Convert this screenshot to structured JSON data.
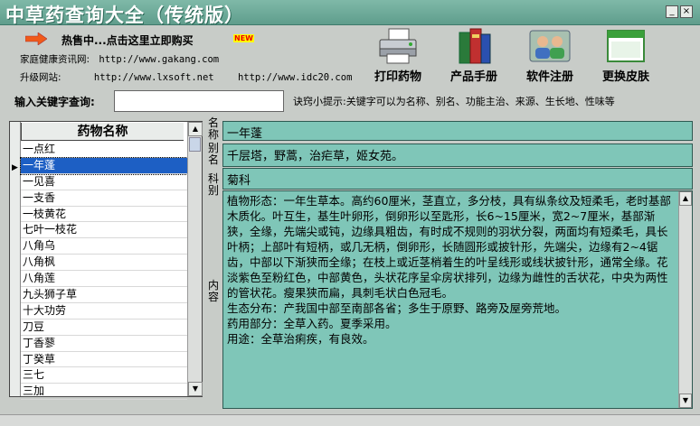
{
  "window": {
    "title": "中草药查询大全（传统版）",
    "min": "_",
    "max": "□",
    "close": "×"
  },
  "promo": {
    "text": "热售中...点击这里立即购买",
    "badge": "NEW"
  },
  "sites": [
    {
      "label": "家庭健康资讯网:",
      "url": "http://www.gakang.com"
    },
    {
      "label": "升级网站:",
      "url": "http://www.lxsoft.net",
      "url2": "http://www.idc20.com"
    }
  ],
  "toolbar": [
    {
      "label": "打印药物",
      "icon": "printer-icon"
    },
    {
      "label": "产品手册",
      "icon": "books-icon"
    },
    {
      "label": "软件注册",
      "icon": "users-icon"
    },
    {
      "label": "更换皮肤",
      "icon": "window-icon"
    }
  ],
  "search": {
    "label": "输入关键字查询:",
    "value": "",
    "tip": "诀窍小提示:关键字可以为名称、别名、功能主治、来源、生长地、性味等"
  },
  "list": {
    "header": "药物名称",
    "items": [
      "一点红",
      "一年蓬",
      "一见喜",
      "一支香",
      "一枝黄花",
      "七叶一枝花",
      "八角乌",
      "八角枫",
      "八角莲",
      "九头狮子草",
      "十大功劳",
      "刀豆",
      "丁香蓼",
      "丁癸草",
      "三七",
      "三加"
    ],
    "selected_index": 1
  },
  "detail": {
    "name_label": "名称",
    "name": "一年蓬",
    "alias_label": "别名",
    "alias": "千层塔，野蒿，治疟草，姬女苑。",
    "family_label": "科别",
    "family": "菊科",
    "content_label": "内容",
    "content": [
      "植物形态：一年生草本。高约60厘米，茎直立，多分枝，具有纵条纹及短柔毛，老时基部木质化。叶互生，基生叶卵形，倒卵形以至匙形，长6~15厘米，宽2~7厘米，基部渐狭，全缘，先端尖或钝，边缘具粗齿，有时成不规则的羽状分裂，两面均有短柔毛，具长叶柄；上部叶有短柄，或几无柄，倒卵形，长随圆形或披针形，先端尖，边缘有2~4锯齿，中部以下渐狭而全缘；在枝上或近茎梢着生的叶呈线形或线状披针形，通常全缘。花淡紫色至粉红色，中部黄色，头状花序呈伞房状排列，边缘为雌性的舌状花，中央为两性的管状花。瘦果狭而扁，具刺毛状白色冠毛。",
      "生态分布：产我国中部至南部各省；多生于原野、路旁及屋旁荒地。",
      "药用部分：全草入药。夏季采用。",
      "用途：全草治痢疾，有良效。"
    ]
  },
  "colors": {
    "titlebar": "#6aa898",
    "field_bg": "#7fc6b8",
    "selected": "#1d5fc4"
  }
}
